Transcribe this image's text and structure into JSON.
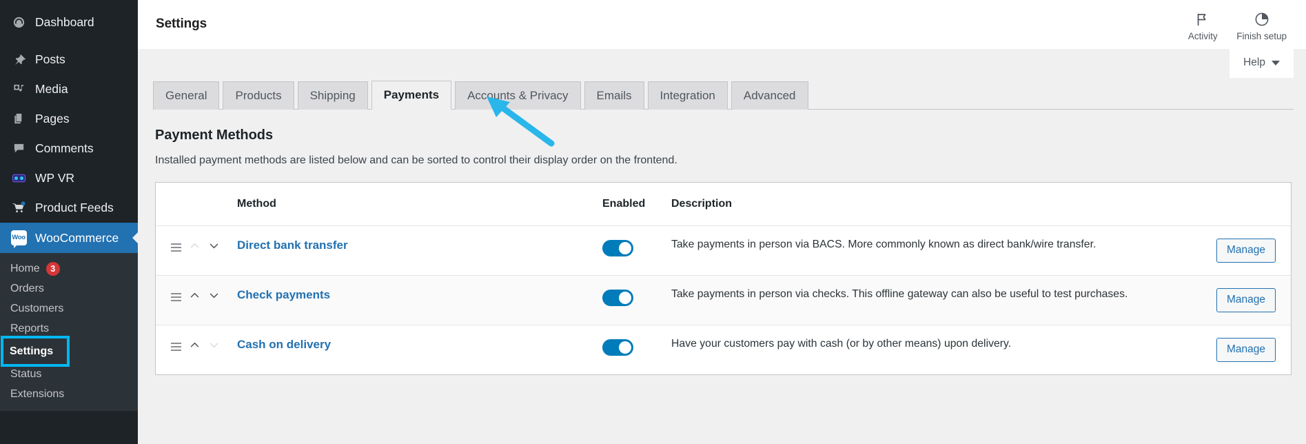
{
  "sidebar": {
    "items": [
      {
        "label": "Dashboard",
        "icon": "dashboard-icon"
      },
      {
        "label": "Posts",
        "icon": "pin-icon"
      },
      {
        "label": "Media",
        "icon": "media-icon"
      },
      {
        "label": "Pages",
        "icon": "pages-icon"
      },
      {
        "label": "Comments",
        "icon": "comment-icon"
      },
      {
        "label": "WP VR",
        "icon": "vr-goggles-icon"
      },
      {
        "label": "Product Feeds",
        "icon": "cart-icon"
      }
    ],
    "active_plugin": {
      "label": "WooCommerce",
      "badge_text": "Woo"
    },
    "submenu": [
      {
        "label": "Home",
        "count": "3"
      },
      {
        "label": "Orders"
      },
      {
        "label": "Customers"
      },
      {
        "label": "Reports"
      },
      {
        "label": "Settings",
        "highlighted": true
      },
      {
        "label": "Status"
      },
      {
        "label": "Extensions"
      }
    ],
    "highlight_color": "#00b7f1",
    "active_color": "#2271b1"
  },
  "header": {
    "title": "Settings",
    "activity_label": "Activity",
    "finish_setup_label": "Finish setup",
    "help_label": "Help"
  },
  "tabs": [
    {
      "label": "General",
      "active": false
    },
    {
      "label": "Products",
      "active": false
    },
    {
      "label": "Shipping",
      "active": false
    },
    {
      "label": "Payments",
      "active": true
    },
    {
      "label": "Accounts & Privacy",
      "active": false
    },
    {
      "label": "Emails",
      "active": false
    },
    {
      "label": "Integration",
      "active": false
    },
    {
      "label": "Advanced",
      "active": false
    }
  ],
  "section": {
    "title": "Payment Methods",
    "description": "Installed payment methods are listed below and can be sorted to control their display order on the frontend."
  },
  "table": {
    "columns": [
      "",
      "Method",
      "Enabled",
      "Description",
      ""
    ],
    "headers": {
      "method": "Method",
      "enabled": "Enabled",
      "description": "Description"
    },
    "rows": [
      {
        "method": "Direct bank transfer",
        "enabled": true,
        "description": "Take payments in person via BACS. More commonly known as direct bank/wire transfer.",
        "action_label": "Manage",
        "up_disabled": true,
        "down_disabled": false
      },
      {
        "method": "Check payments",
        "enabled": true,
        "description": "Take payments in person via checks. This offline gateway can also be useful to test purchases.",
        "action_label": "Manage",
        "up_disabled": false,
        "down_disabled": false
      },
      {
        "method": "Cash on delivery",
        "enabled": true,
        "description": "Have your customers pay with cash (or by other means) upon delivery.",
        "action_label": "Manage",
        "up_disabled": false,
        "down_disabled": true
      }
    ]
  },
  "annotation": {
    "arrow_color": "#29b6ea",
    "points_to": "Payments"
  }
}
